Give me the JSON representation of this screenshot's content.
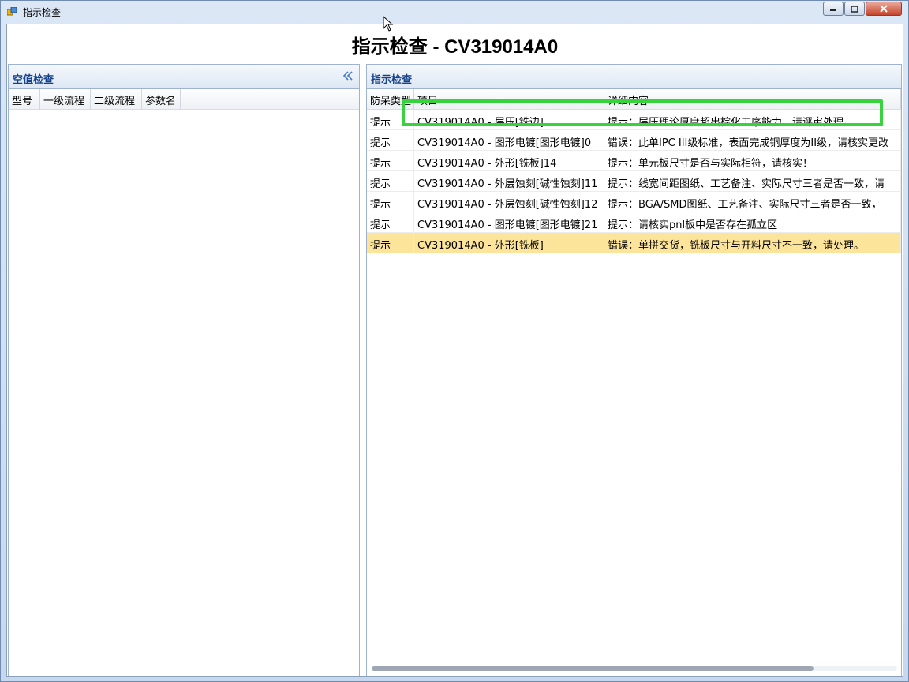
{
  "window": {
    "title": "指示检查"
  },
  "header": {
    "title": "指示检查 - CV319014A0"
  },
  "left_panel": {
    "title": "空值检查",
    "columns": [
      "型号",
      "一级流程",
      "二级流程",
      "参数名"
    ]
  },
  "right_panel": {
    "title": "指示检查",
    "columns": [
      "防呆类型",
      "项目",
      "详细内容"
    ],
    "rows": [
      {
        "type": "提示",
        "item": "CV319014A0 - 层压[铣边]",
        "detail": "提示：层压理论厚度超出棕化工序能力，请评审处理。"
      },
      {
        "type": "提示",
        "item": "CV319014A0 - 图形电镀[图形电镀]0",
        "detail": "错误：此单IPC III级标准，表面完成铜厚度为II级，请核实更改"
      },
      {
        "type": "提示",
        "item": "CV319014A0 - 外形[铣板]14",
        "detail": "提示：单元板尺寸是否与实际相符，请核实！"
      },
      {
        "type": "提示",
        "item": "CV319014A0 - 外层蚀刻[碱性蚀刻]11",
        "detail": "提示：线宽间距图纸、工艺备注、实际尺寸三者是否一致，请"
      },
      {
        "type": "提示",
        "item": "CV319014A0 - 外层蚀刻[碱性蚀刻]12",
        "detail": "提示：BGA/SMD图纸、工艺备注、实际尺寸三者是否一致，"
      },
      {
        "type": "提示",
        "item": "CV319014A0 - 图形电镀[图形电镀]21",
        "detail": "提示：请核实pnl板中是否存在孤立区"
      },
      {
        "type": "提示",
        "item": "CV319014A0 - 外形[铣板]",
        "detail": "错误：单拼交货，铣板尺寸与开料尺寸不一致，请处理。",
        "selected": true
      }
    ]
  },
  "colors": {
    "accent": "#15428b",
    "selected_row": "#fde49b",
    "highlight": "#37d23e"
  },
  "icons": {
    "app": "app-icon",
    "collapse": "double-chevron-left-icon"
  }
}
